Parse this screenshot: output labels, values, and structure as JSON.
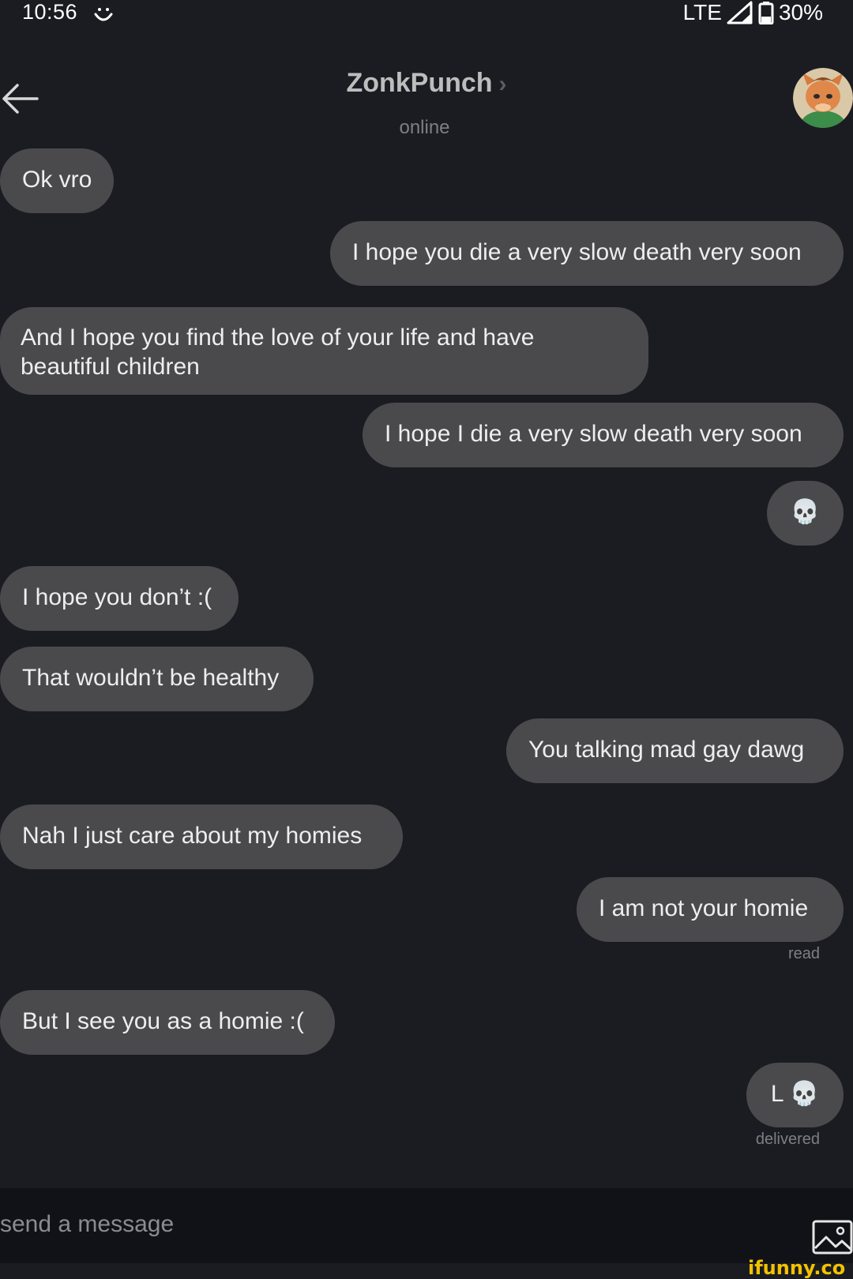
{
  "status_bar": {
    "time": "10:56",
    "network": "LTE",
    "battery": "30%",
    "icons": [
      "smiley-icon",
      "signal-icon",
      "battery-icon"
    ]
  },
  "header": {
    "contact_name": "ZonkPunch",
    "chevron": "›",
    "status": "online",
    "icons": [
      "back-arrow-icon",
      "avatar"
    ]
  },
  "messages": [
    {
      "side": "received",
      "text": "Ok vro"
    },
    {
      "side": "sent",
      "text": "I hope you die a very slow death very soon"
    },
    {
      "side": "received",
      "text": "And I hope you find the love of your life and have beautiful children"
    },
    {
      "side": "sent",
      "text": "I hope I die a very slow death very soon"
    },
    {
      "side": "sent",
      "text": "💀"
    },
    {
      "side": "received",
      "text": "I hope you don’t :("
    },
    {
      "side": "received",
      "text": "That wouldn’t be healthy"
    },
    {
      "side": "sent",
      "text": "You talking mad gay dawg"
    },
    {
      "side": "received",
      "text": "Nah I just care about my homies"
    },
    {
      "side": "sent",
      "text": "I am not your homie",
      "receipt": "read"
    },
    {
      "side": "received",
      "text": "But I see you as a homie :("
    },
    {
      "side": "sent",
      "text": "L 💀",
      "receipt": "delivered"
    }
  ],
  "composer": {
    "placeholder": "send a message",
    "icons": [
      "image-attach-icon"
    ]
  },
  "watermark": "ifunny.co",
  "colors": {
    "background": "#1b1c22",
    "bubble": "#4a4a4d",
    "composer": "#111217",
    "muted_text": "#7c7f87",
    "watermark": "#f2c200"
  }
}
